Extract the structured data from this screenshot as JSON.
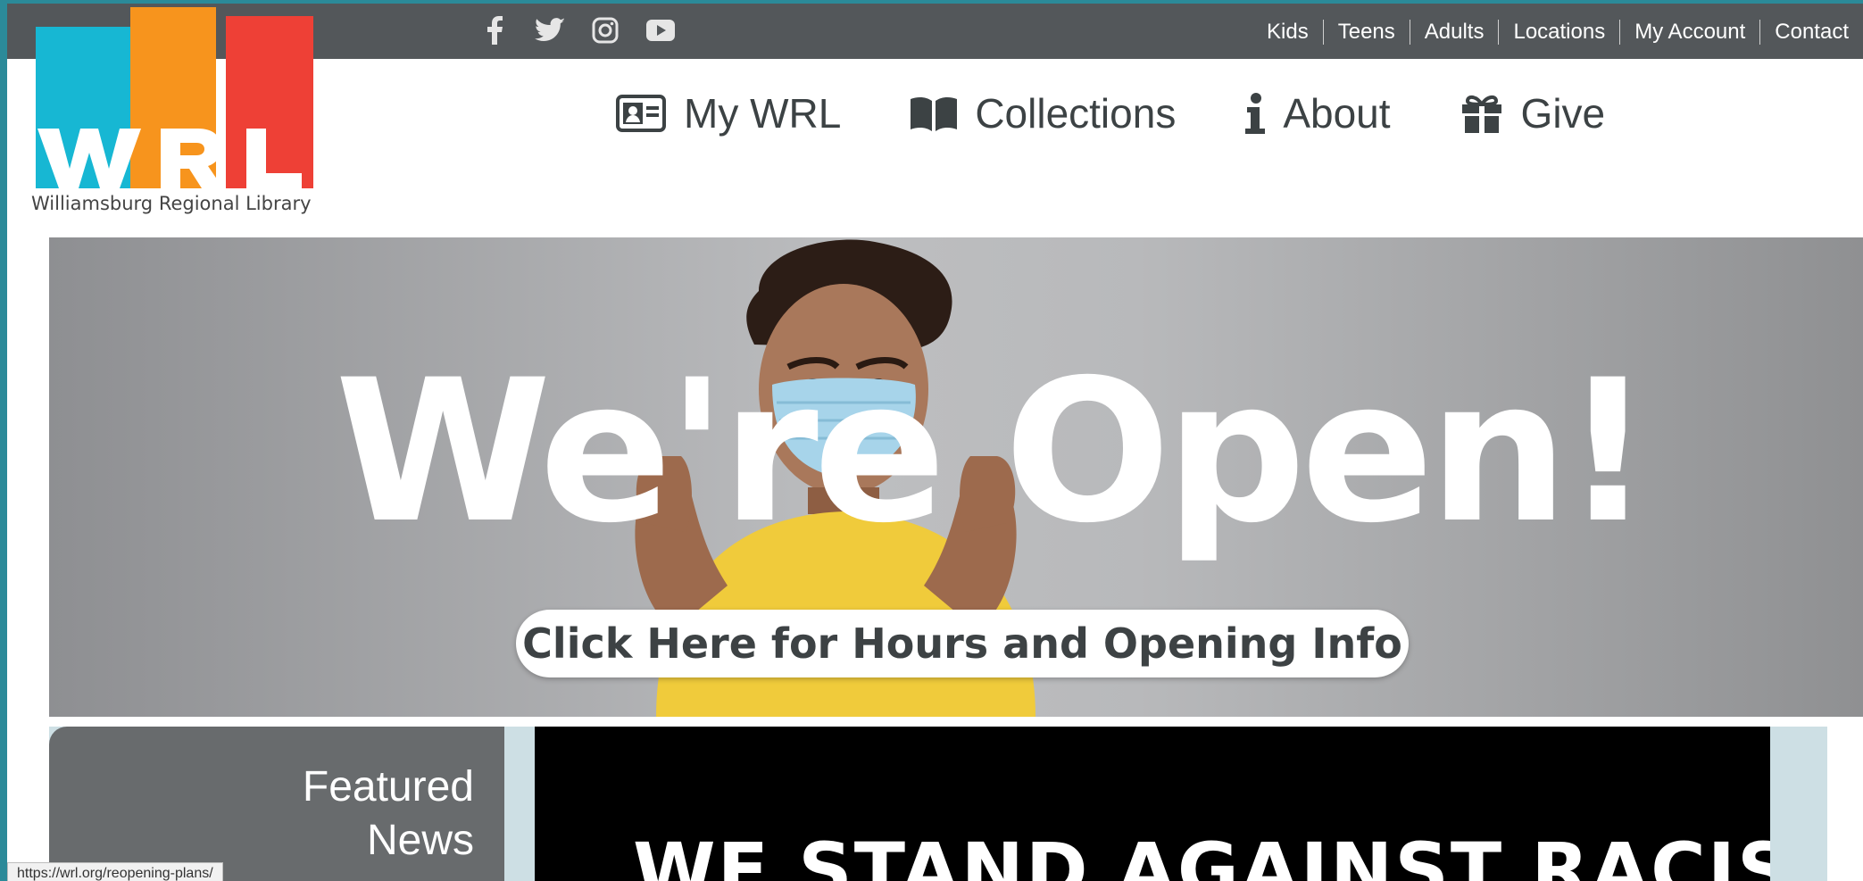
{
  "site": {
    "logo_text": "WRL",
    "tagline": "Williamsburg Regional Library",
    "brand_colors": [
      "#17b7d3",
      "#f7941d",
      "#ee4036"
    ]
  },
  "social": [
    {
      "name": "facebook-icon"
    },
    {
      "name": "twitter-icon"
    },
    {
      "name": "instagram-icon"
    },
    {
      "name": "youtube-icon"
    }
  ],
  "utility_nav": [
    "Kids",
    "Teens",
    "Adults",
    "Locations",
    "My Account",
    "Contact"
  ],
  "main_nav": [
    {
      "label": "My WRL",
      "icon": "id-card-icon"
    },
    {
      "label": "Collections",
      "icon": "book-icon"
    },
    {
      "label": "About",
      "icon": "info-icon"
    },
    {
      "label": "Give",
      "icon": "gift-icon"
    }
  ],
  "hero": {
    "title": "We're Open!",
    "cta": "Click Here for Hours and Opening Info"
  },
  "featured": {
    "label_line1": "Featured",
    "label_line2": "News",
    "headline": "WE STAND AGAINST RACISM"
  },
  "status_url": "https://wrl.org/reopening-plans/"
}
